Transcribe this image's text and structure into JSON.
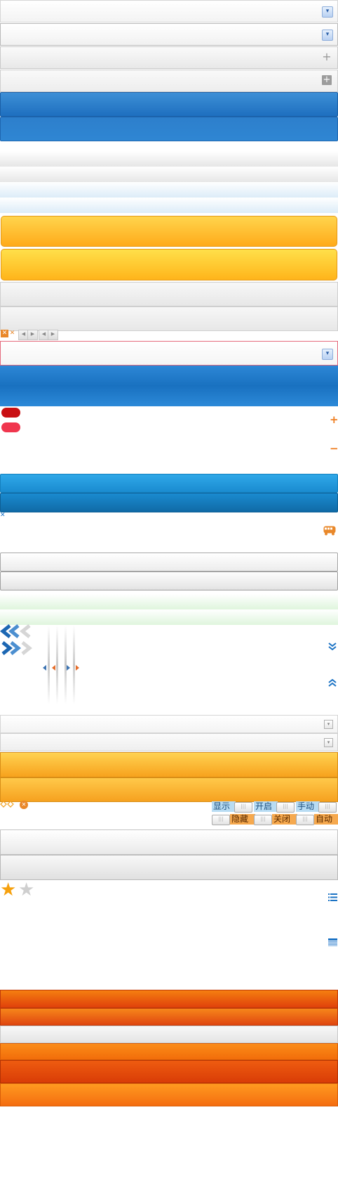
{
  "toggles": {
    "top_row": {
      "show_label": "显示",
      "on_label": "开启",
      "manual_label": "手动",
      "background": "#b8dcf3",
      "text_color": "#1d4f7d"
    },
    "bottom_row": {
      "hide_label": "隐藏",
      "off_label": "关闭",
      "auto_label": "自动",
      "background": "#f6a94e",
      "text_color": "#5a2a00"
    }
  },
  "glyphs": {
    "dropdown_arrow": "▾",
    "plus": "+",
    "minus": "−",
    "close_x": "✕",
    "star": "★",
    "prev": "◀",
    "next": "▶",
    "switch_grip": "|||"
  },
  "colors": {
    "accent_blue": "#1e6fbf",
    "accent_orange": "#f26d0a",
    "accent_yellow": "#ffaa1a",
    "red_pill": "#c90f12",
    "pink_pill": "#f0364e"
  }
}
